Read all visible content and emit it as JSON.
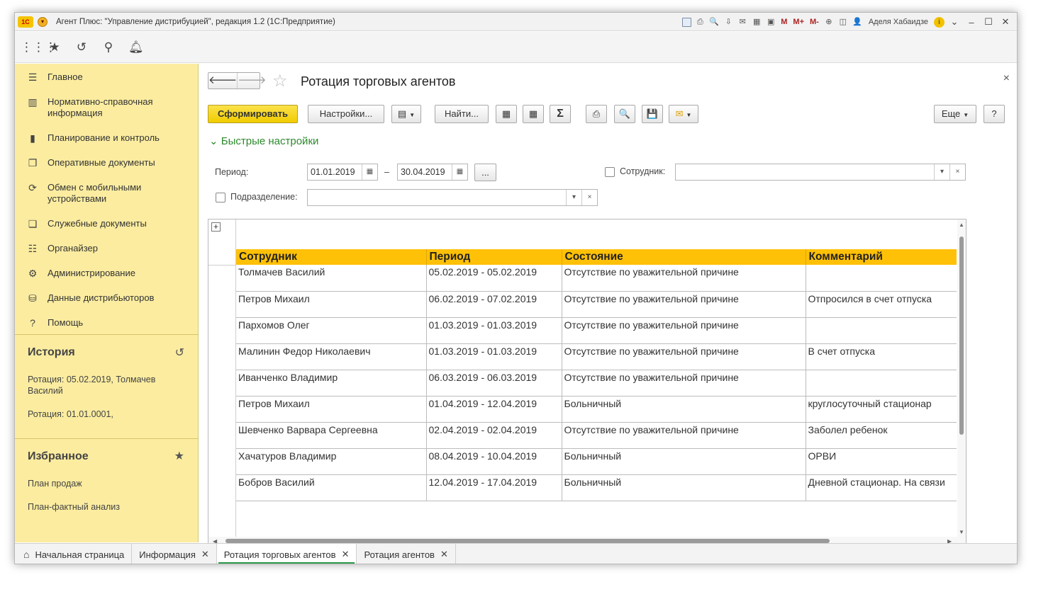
{
  "window": {
    "title": "Агент Плюс: \"Управление дистрибуцией\", редакция 1.2  (1С:Предприятие)",
    "user": "Аделя Хабаидзе"
  },
  "sidebar": {
    "items": [
      {
        "label": "Главное",
        "icon": "menu-icon"
      },
      {
        "label": "Нормативно-справочная информация",
        "icon": "grid-icon"
      },
      {
        "label": "Планирование и контроль",
        "icon": "chart-icon"
      },
      {
        "label": "Оперативные документы",
        "icon": "documents-icon"
      },
      {
        "label": "Обмен с мобильными устройствами",
        "icon": "sync-icon"
      },
      {
        "label": "Служебные документы",
        "icon": "service-docs-icon"
      },
      {
        "label": "Органайзер",
        "icon": "organizer-icon"
      },
      {
        "label": "Администрирование",
        "icon": "gear-icon"
      },
      {
        "label": "Данные дистрибьюторов",
        "icon": "database-icon"
      },
      {
        "label": "Помощь",
        "icon": "help-icon"
      }
    ],
    "history": {
      "title": "История",
      "links": [
        "Ротация: 05.02.2019, Толмачев Василий",
        "Ротация: 01.01.0001,"
      ]
    },
    "favorites": {
      "title": "Избранное",
      "links": [
        "План продаж",
        "План-фактный анализ"
      ]
    }
  },
  "main": {
    "title": "Ротация торговых агентов",
    "buttons": {
      "generate": "Сформировать",
      "settings": "Настройки...",
      "find": "Найти...",
      "more": "Еще",
      "help": "?"
    },
    "quick_settings": "Быстрые настройки",
    "period_label": "Период:",
    "period_from": "01.01.2019",
    "period_to": "30.04.2019",
    "period_dash": "–",
    "period_more": "...",
    "employee_label": "Сотрудник:",
    "employee_value": "",
    "department_label": "Подразделение:",
    "department_value": ""
  },
  "report": {
    "columns": [
      "Сотрудник",
      "Период",
      "Состояние",
      "Комментарий"
    ],
    "rows": [
      [
        "Толмачев Василий",
        "05.02.2019 - 05.02.2019",
        "Отсутствие по уважительной причине",
        ""
      ],
      [
        "Петров Михаил",
        "06.02.2019 - 07.02.2019",
        "Отсутствие по уважительной причине",
        "Отпросился в счет отпуска"
      ],
      [
        "Пархомов Олег",
        "01.03.2019 - 01.03.2019",
        "Отсутствие по уважительной причине",
        ""
      ],
      [
        "Малинин Федор Николаевич",
        "01.03.2019 - 01.03.2019",
        "Отсутствие по уважительной причине",
        "В счет отпуска"
      ],
      [
        "Иванченко Владимир",
        "06.03.2019 - 06.03.2019",
        "Отсутствие по уважительной причине",
        ""
      ],
      [
        "Петров Михаил",
        "01.04.2019 - 12.04.2019",
        "Больничный",
        "круглосуточный стационар"
      ],
      [
        "Шевченко Варвара Сергеевна",
        "02.04.2019 - 02.04.2019",
        "Отсутствие по уважительной причине",
        "Заболел ребенок"
      ],
      [
        "Хачатуров Владимир",
        "08.04.2019 - 10.04.2019",
        "Больничный",
        "ОРВИ"
      ],
      [
        "Бобров Василий",
        "12.04.2019 - 17.04.2019",
        "Больничный",
        "Дневной стационар. На связи"
      ]
    ]
  },
  "tabs": [
    {
      "label": "Начальная страница",
      "closable": false
    },
    {
      "label": "Информация",
      "closable": true
    },
    {
      "label": "Ротация торговых агентов",
      "closable": true,
      "active": true
    },
    {
      "label": "Ротация агентов",
      "closable": true
    }
  ],
  "colors": {
    "sidebar_bg": "#fbeca0",
    "header_yellow": "#ffc107",
    "primary_button": "#f0cc00",
    "quick_settings_green": "#2d8a2d"
  }
}
